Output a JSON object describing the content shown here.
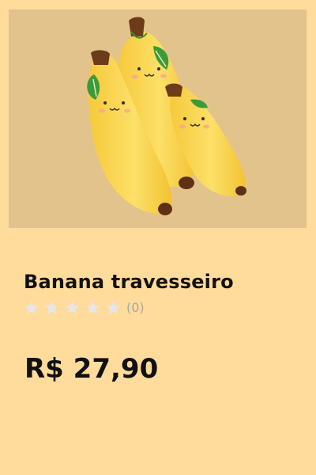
{
  "product": {
    "image_alt": "Banana travesseiro",
    "title": "Banana travesseiro",
    "rating": {
      "stars_total": 5,
      "stars_filled": 0,
      "review_count": "(0)",
      "star_color_empty": "#E6E6E6"
    },
    "price": "R$ 27,90"
  },
  "colors": {
    "page_background": "#FFDB9C",
    "image_background": "#E3C38C",
    "banana": "#F9D24A",
    "text": "#111111",
    "muted": "#A7A7A7"
  }
}
